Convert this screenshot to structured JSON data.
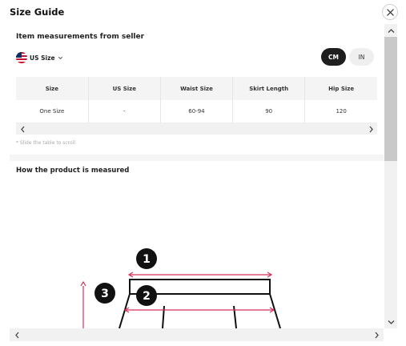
{
  "modal": {
    "title": "Size Guide"
  },
  "seller_section": {
    "label": "Item measurements from seller",
    "region": "US Size",
    "units": [
      {
        "label": "CM",
        "active": true
      },
      {
        "label": "IN",
        "active": false
      }
    ]
  },
  "size_table": {
    "headers": [
      "Size",
      "US Size",
      "Waist Size",
      "Skirt Length",
      "Hip Size"
    ],
    "rows": [
      [
        "One Size",
        "-",
        "60-94",
        "90",
        "120"
      ]
    ]
  },
  "scroll_hint": "* Slide the table to scroll",
  "measure_section": {
    "title": "How the product is measured",
    "markers": [
      "1",
      "2",
      "3"
    ]
  },
  "icons": {
    "close": "close-icon",
    "region_chevron": "chevron-down-icon",
    "flag": "us-flag-icon",
    "scroll_left": "chevron-left-icon",
    "scroll_right": "chevron-right-icon",
    "scroll_up": "chevron-up-icon",
    "scroll_down": "chevron-down-icon"
  },
  "colors": {
    "accent_measure": "#d3305a",
    "toggle_active_bg": "#1e1e1e",
    "toggle_inactive_bg": "#efefef",
    "table_header_bg": "#f4f4f4"
  }
}
